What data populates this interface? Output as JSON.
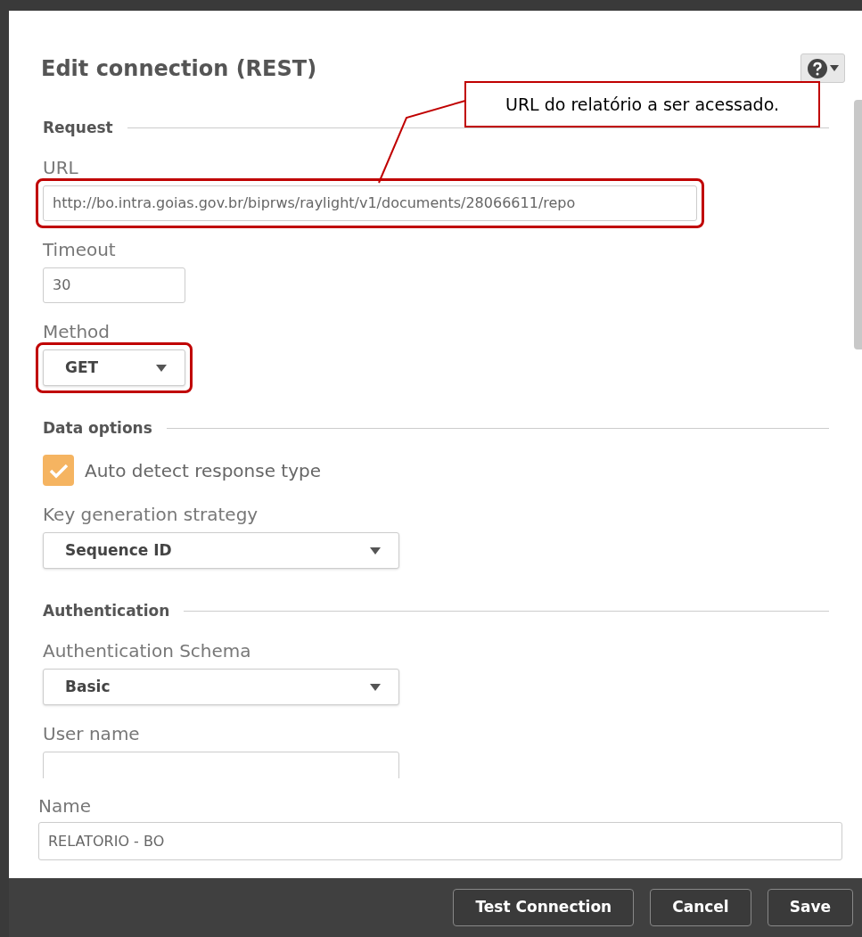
{
  "dialog": {
    "title": "Edit connection (REST)"
  },
  "sections": [
    {
      "heading": "Request",
      "items": [
        {
          "kind": "input",
          "label": "URL",
          "value": "http://bo.intra.goias.gov.br/biprws/raylight/v1/documents/28066611/repo",
          "highlighted": true
        },
        {
          "kind": "input",
          "label": "Timeout",
          "value": "30",
          "highlighted": false
        },
        {
          "kind": "select",
          "label": "Method",
          "value": "GET",
          "highlighted": true
        }
      ]
    },
    {
      "heading": "Data options",
      "items": [
        {
          "kind": "checkbox",
          "label": "Auto detect response type",
          "checked": true
        },
        {
          "kind": "select",
          "label": "Key generation strategy",
          "value": "Sequence ID",
          "highlighted": false
        }
      ]
    },
    {
      "heading": "Authentication",
      "items": [
        {
          "kind": "select",
          "label": "Authentication Schema",
          "value": "Basic",
          "highlighted": false
        },
        {
          "kind": "input",
          "label": "User name",
          "highlighted": false
        }
      ]
    }
  ],
  "name_field": {
    "label": "Name",
    "value": "RELATORIO - BO"
  },
  "buttons": [
    "Test Connection",
    "Cancel",
    "Save"
  ],
  "callout": {
    "text": "URL do relatório a ser acessado."
  }
}
